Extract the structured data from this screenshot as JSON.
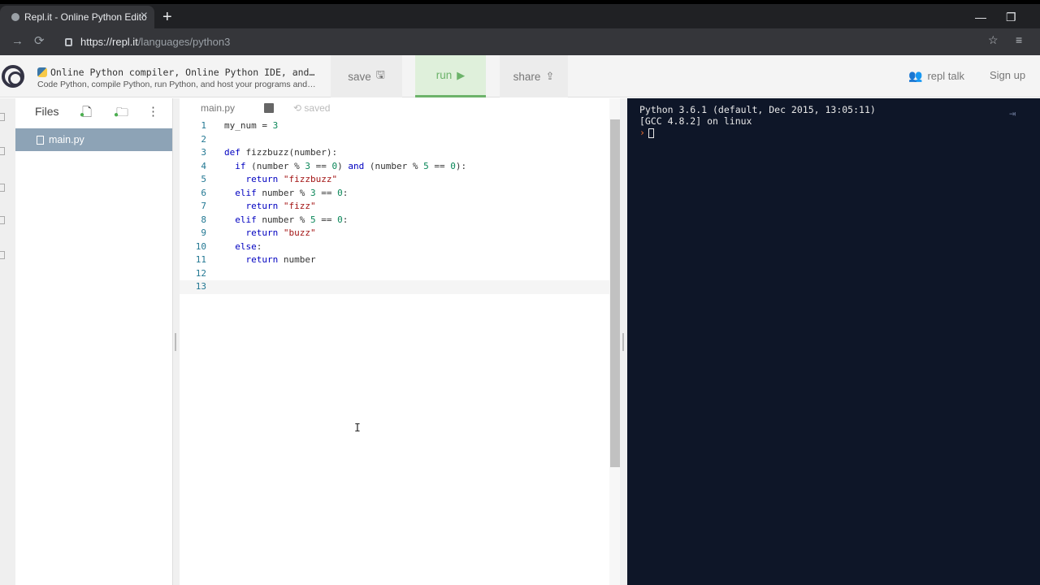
{
  "browser": {
    "tab_title": "Repl.it - Online Python Editor and",
    "tab_close": "×",
    "new_tab": "+",
    "url_host": "https://repl.it",
    "url_path": "/languages/python3",
    "back": "←",
    "forward": "→",
    "reload": "⟳",
    "star": "☆",
    "extensions": "≡",
    "minimize": "—",
    "restore": "❐",
    "close": "✕"
  },
  "header": {
    "title": "Online Python compiler, Online Python IDE, and…",
    "subtitle": "Code Python, compile Python, run Python, and host your programs and…",
    "save_label": "save",
    "run_label": "run",
    "share_label": "share",
    "repl_talk_label": "repl talk",
    "signup_label": "Sign up",
    "save_icon": "floppy-icon",
    "run_icon": "play-icon",
    "share_icon": "share-icon"
  },
  "files": {
    "label": "Files",
    "items": [
      {
        "name": "main.py",
        "selected": true
      }
    ]
  },
  "editor": {
    "tab_label": "main.py",
    "saved_label": "saved",
    "active_line": 13,
    "lines": [
      {
        "n": "1",
        "text": "my_num = 3"
      },
      {
        "n": "2",
        "text": ""
      },
      {
        "n": "3",
        "text": "def fizzbuzz(number):"
      },
      {
        "n": "4",
        "text": "  if (number % 3 == 0) and (number % 5 == 0):"
      },
      {
        "n": "5",
        "text": "    return \"fizzbuzz\""
      },
      {
        "n": "6",
        "text": "  elif number % 3 == 0:"
      },
      {
        "n": "7",
        "text": "    return \"fizz\""
      },
      {
        "n": "8",
        "text": "  elif number % 5 == 0:"
      },
      {
        "n": "9",
        "text": "    return \"buzz\""
      },
      {
        "n": "10",
        "text": "  else:"
      },
      {
        "n": "11",
        "text": "    return number"
      },
      {
        "n": "12",
        "text": ""
      },
      {
        "n": "13",
        "text": ""
      }
    ]
  },
  "console": {
    "line1": "Python 3.6.1 (default, Dec 2015, 13:05:11)",
    "line2": "[GCC 4.8.2] on linux",
    "prompt": "›"
  },
  "colors": {
    "console_bg": "#0e1628",
    "run_accent": "#6cb36a",
    "file_selected": "#8da3b6"
  }
}
